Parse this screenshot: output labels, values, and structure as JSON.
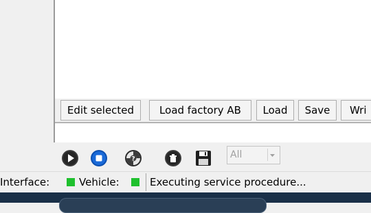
{
  "buttons": {
    "edit_selected": "Edit selected",
    "load_factory_ab": "Load factory AB",
    "load": "Load",
    "save": "Save",
    "write_truncated": "Wri"
  },
  "toolbar": {
    "icons": [
      "play-icon",
      "stop-icon",
      "help-lifebuoy-icon",
      "delete-icon",
      "save-disk-icon"
    ],
    "filter_select": {
      "value": "All"
    }
  },
  "status": {
    "interface_label": "Interface:",
    "vehicle_label": "Vehicle:",
    "message": "Executing service procedure...",
    "led_color": "#1fc02e"
  }
}
